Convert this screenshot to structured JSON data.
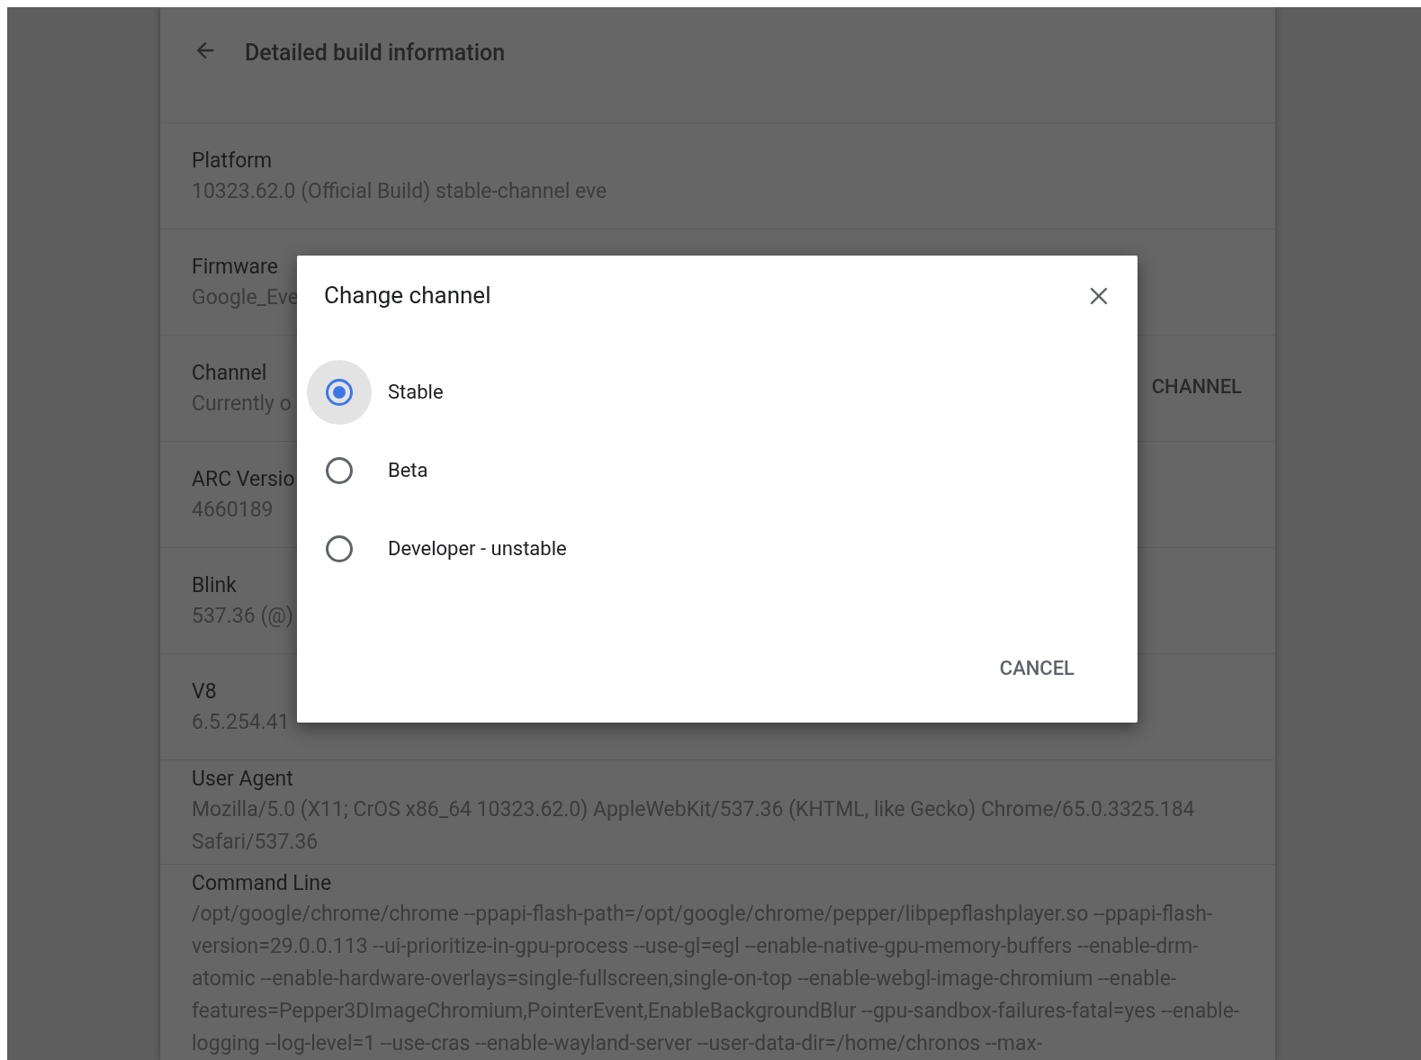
{
  "page": {
    "title": "Detailed build information"
  },
  "rows": [
    {
      "label": "Platform",
      "value": "10323.62.0 (Official Build) stable-channel eve"
    },
    {
      "label": "Firmware",
      "value": "Google_Eve"
    },
    {
      "label": "Channel",
      "value": "Currently o",
      "action": "CHANNEL"
    },
    {
      "label": "ARC Versio",
      "value": "4660189"
    },
    {
      "label": "Blink",
      "value": "537.36 (@)"
    },
    {
      "label": "V8",
      "value": "6.5.254.41"
    },
    {
      "label": "User Agent",
      "value": "Mozilla/5.0 (X11; CrOS x86_64 10323.62.0) AppleWebKit/537.36 (KHTML, like Gecko) Chrome/65.0.3325.184 Safari/537.36"
    },
    {
      "label": "Command Line",
      "value": "/opt/google/chrome/chrome --ppapi-flash-path=/opt/google/chrome/pepper/libpepflashplayer.so --ppapi-flash-version=29.0.0.113 --ui-prioritize-in-gpu-process --use-gl=egl --enable-native-gpu-memory-buffers --enable-drm-atomic --enable-hardware-overlays=single-fullscreen,single-on-top --enable-webgl-image-chromium --enable-features=Pepper3DImageChromium,PointerEvent,EnableBackgroundBlur --gpu-sandbox-failures-fatal=yes --enable-logging --log-level=1 --use-cras --enable-wayland-server --user-data-dir=/home/chronos --max-"
    }
  ],
  "dialog": {
    "title": "Change channel",
    "options": [
      {
        "label": "Stable",
        "selected": true
      },
      {
        "label": "Beta",
        "selected": false
      },
      {
        "label": "Developer - unstable",
        "selected": false
      }
    ],
    "cancel": "CANCEL"
  }
}
